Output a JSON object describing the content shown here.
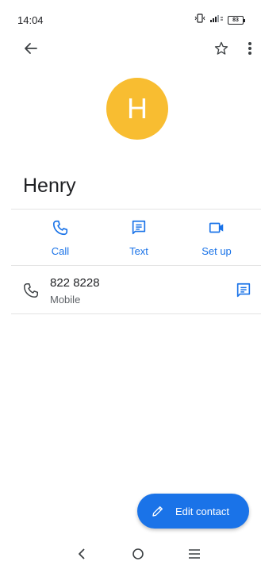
{
  "status": {
    "time": "14:04",
    "battery": "83",
    "icons": [
      "vibrate-icon",
      "signal-icon",
      "battery-icon"
    ]
  },
  "top_bar": {
    "icons": [
      "back-arrow-icon",
      "star-outline-icon",
      "more-vert-icon"
    ]
  },
  "contact": {
    "initial": "H",
    "name": "Henry",
    "avatar_color": "#f8bd31"
  },
  "actions": [
    {
      "label": "Call",
      "icon": "phone-icon"
    },
    {
      "label": "Text",
      "icon": "message-icon"
    },
    {
      "label": "Set up",
      "icon": "video-icon"
    }
  ],
  "phone": {
    "number": "822 8228",
    "type": "Mobile",
    "icons": [
      "phone-icon",
      "message-icon"
    ]
  },
  "fab": {
    "label": "Edit contact",
    "icon": "pencil-icon",
    "color": "#1a73e8"
  },
  "nav": {
    "icons": [
      "nav-back-icon",
      "nav-home-icon",
      "nav-menu-icon"
    ]
  },
  "colors": {
    "accent": "#1a73e8",
    "text_primary": "#202124",
    "text_secondary": "#5f6368"
  }
}
